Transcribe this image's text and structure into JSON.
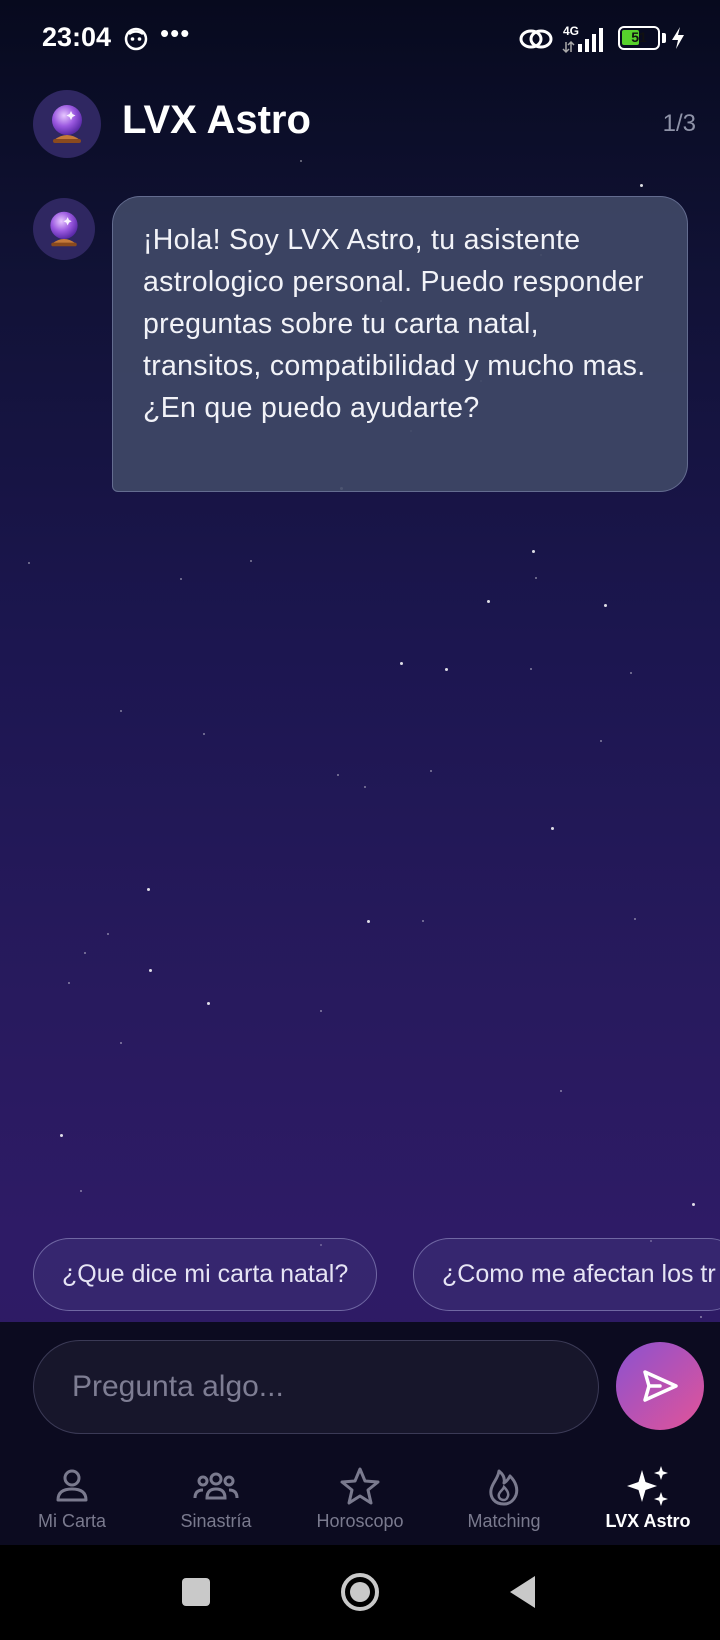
{
  "status_bar": {
    "time": "23:04",
    "more": "•••",
    "network": "4G",
    "battery_level": "51"
  },
  "header": {
    "avatar_emoji": "🔮",
    "title": "LVX Astro",
    "page_count": "1/3"
  },
  "chat": {
    "messages": [
      {
        "role": "assistant",
        "avatar_emoji": "🔮",
        "text": "¡Hola! Soy LVX Astro, tu asistente astrologico personal. Puedo responder preguntas sobre tu carta natal, transitos, compatibilidad y mucho mas. ¿En que puedo ayudarte?"
      }
    ]
  },
  "suggestions": [
    "¿Que dice mi carta natal?",
    "¿Como me afectan los tr"
  ],
  "composer": {
    "placeholder": "Pregunta algo...",
    "send_icon": "send-icon"
  },
  "bottom_nav": {
    "items": [
      {
        "label": "Mi Carta",
        "icon": "person-icon",
        "active": false
      },
      {
        "label": "Sinastría",
        "icon": "group-icon",
        "active": false
      },
      {
        "label": "Horoscopo",
        "icon": "star-icon",
        "active": false
      },
      {
        "label": "Matching",
        "icon": "flame-icon",
        "active": false
      },
      {
        "label": "LVX Astro",
        "icon": "sparkles-icon",
        "active": true
      }
    ]
  },
  "system_nav": [
    "recents-button",
    "home-button",
    "back-button"
  ],
  "colors": {
    "accent_gradient_start": "#8b52d0",
    "accent_gradient_end": "#e25398",
    "bubble_bg": "#3f4866",
    "battery_green": "#57d12c"
  }
}
